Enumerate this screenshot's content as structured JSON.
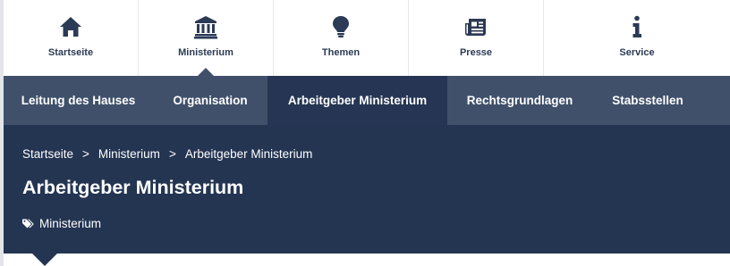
{
  "topnav": {
    "items": [
      {
        "label": "Startseite",
        "icon": "home-icon",
        "active": false
      },
      {
        "label": "Ministerium",
        "icon": "institution-icon",
        "active": true
      },
      {
        "label": "Themen",
        "icon": "lightbulb-icon",
        "active": false
      },
      {
        "label": "Presse",
        "icon": "newspaper-icon",
        "active": false
      },
      {
        "label": "Service",
        "icon": "info-icon",
        "active": false
      }
    ]
  },
  "subnav": {
    "items": [
      {
        "label": "Leitung des Hauses",
        "active": false
      },
      {
        "label": "Organisation",
        "active": false
      },
      {
        "label": "Arbeitgeber Ministerium",
        "active": true
      },
      {
        "label": "Rechtsgrundlagen",
        "active": false
      },
      {
        "label": "Stabsstellen",
        "active": false
      }
    ]
  },
  "breadcrumb": {
    "items": [
      "Startseite",
      "Ministerium",
      "Arbeitgeber Ministerium"
    ],
    "separator": ">"
  },
  "page": {
    "title": "Arbeitgeber Ministerium",
    "tag": "Ministerium",
    "tag_icon": "tags-icon"
  },
  "colors": {
    "icon_navy": "#2b3a55",
    "subnav_bg": "#40506b",
    "subnav_active_bg": "#253553",
    "hero_bg": "#243552",
    "text_white": "#ffffff"
  }
}
